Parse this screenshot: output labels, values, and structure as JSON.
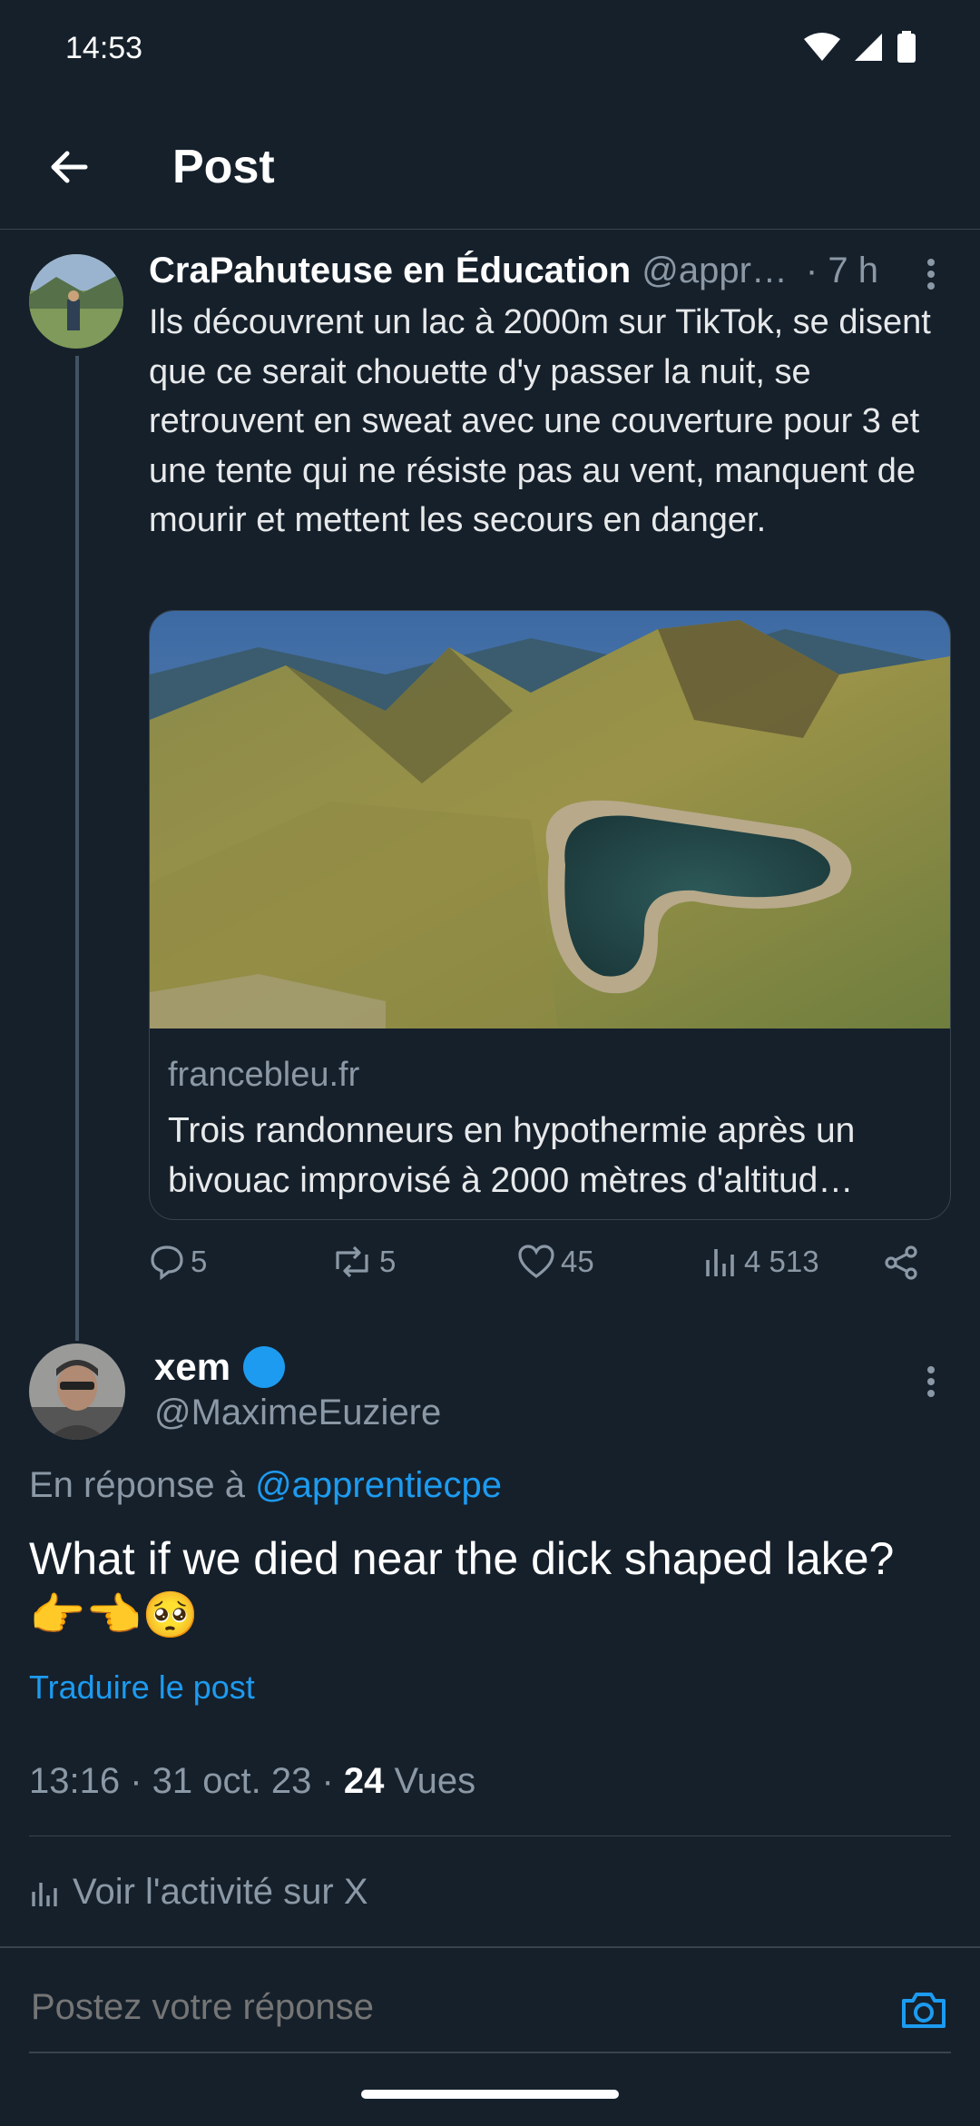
{
  "status_bar": {
    "time": "14:53"
  },
  "header": {
    "title": "Post"
  },
  "parent_tweet": {
    "author_name": "CraPahuteuse en Éducation",
    "author_handle": "@appr…",
    "time": "· 7 h",
    "text": "Ils découvrent un lac à 2000m sur TikTok, se disent que ce serait chouette d'y passer la nuit, se retrouvent en sweat avec une couverture pour 3 et une tente qui ne résiste pas au vent, manquent de mourir et mettent les secours en danger.",
    "card": {
      "domain": "francebleu.fr",
      "title_line1": "Trois randonneurs en hypothermie après un",
      "title_line2": "bivouac improvisé à 2000 mètres d'altitud…"
    },
    "stats": {
      "replies": "5",
      "reposts": "5",
      "likes": "45",
      "views": "4 513"
    }
  },
  "main_tweet": {
    "author_name": "xem",
    "author_handle": "@MaximeEuziere",
    "reply_prefix": "En réponse à",
    "reply_mention": "@apprentiecpe",
    "text": "What if we died near the dick shaped lake? 👉👈🥺",
    "translate_link": "Traduire le post",
    "time": "13:16 · 31 oct. 23 · ",
    "views_count": "24",
    "views_label": " Vues",
    "activity_link": "Voir l'activité sur X"
  },
  "reply_bar": {
    "placeholder": "Postez votre réponse"
  },
  "colors": {
    "background": "#15202b",
    "accent": "#1d9bf0",
    "muted": "#8b98a5",
    "border": "#38444d"
  }
}
